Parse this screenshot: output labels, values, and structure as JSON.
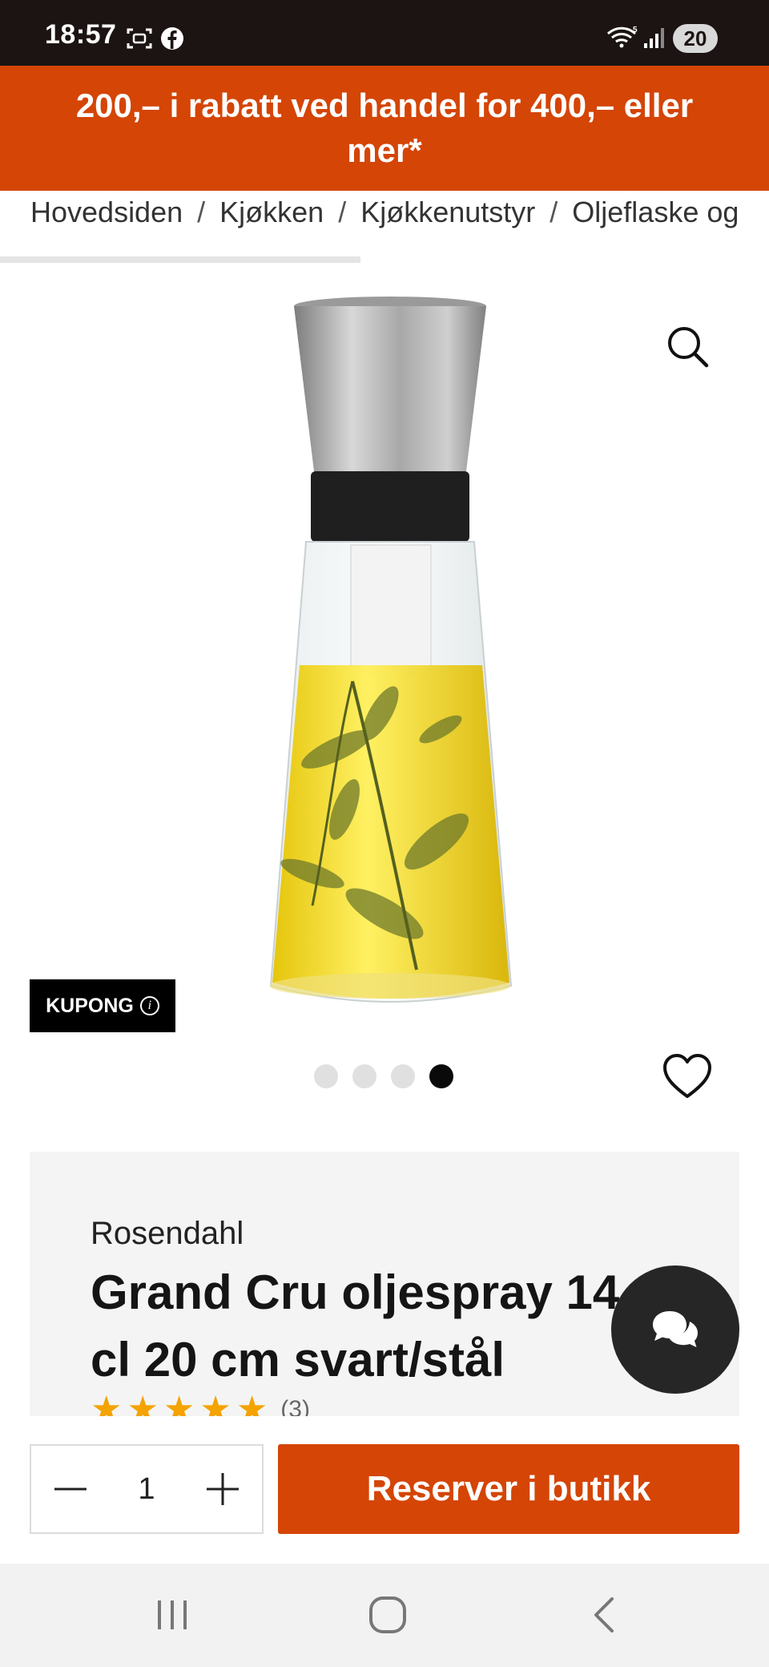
{
  "status_bar": {
    "time": "18:57",
    "battery": "20",
    "icons": [
      "screenshot-icon",
      "facebook-icon",
      "wifi-icon",
      "signal-icon",
      "battery-icon"
    ]
  },
  "promo": {
    "text": "200,– i rabatt ved handel for 400,– eller mer*"
  },
  "breadcrumb": {
    "items": [
      "Hovedsiden",
      "Kjøkken",
      "Kjøkkenutstyr",
      "Oljeflaske og"
    ],
    "separator": "/"
  },
  "product": {
    "coupon_label": "KUPONG",
    "coupon_info": "i",
    "brand": "Rosendahl",
    "title": "Grand Cru oljespray 14 cl 20 cm svart/stål",
    "rating_stars": 5,
    "rating_count": "(3)",
    "image_count": 4,
    "active_image": 4
  },
  "actions": {
    "quantity": "1",
    "reserve_label": "Reserver i butikk"
  },
  "colors": {
    "accent": "#d44506",
    "status_bar": "#1c1412",
    "star": "#f4a300"
  }
}
